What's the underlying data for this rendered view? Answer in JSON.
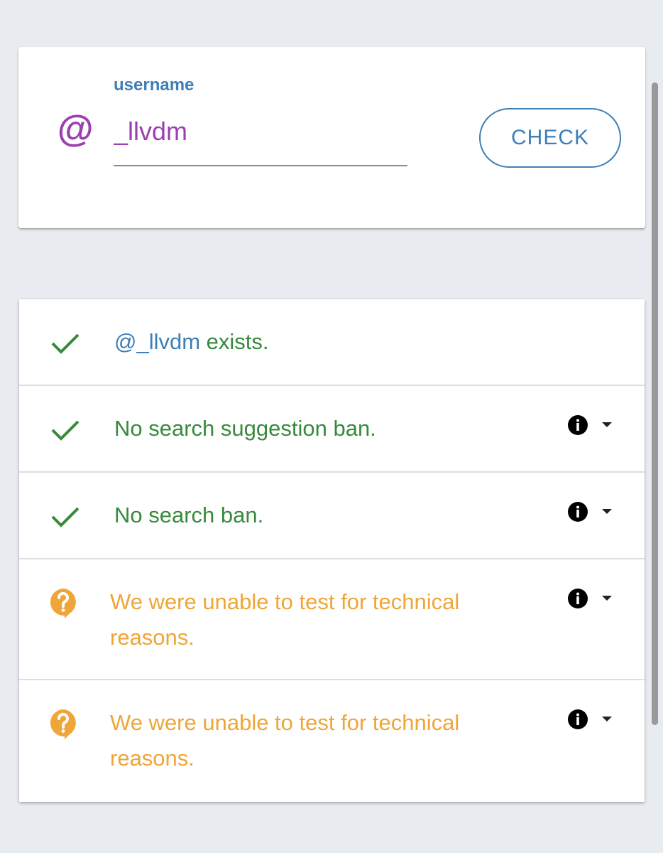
{
  "search": {
    "label": "username",
    "value": "_llvdm",
    "check_label": "CHECK",
    "at_symbol": "@"
  },
  "results": [
    {
      "status": "ok",
      "handle": "@_llvdm",
      "text": " exists."
    },
    {
      "status": "ok",
      "text": "No search suggestion ban."
    },
    {
      "status": "ok",
      "text": "No search ban."
    },
    {
      "status": "unknown",
      "text": "We were unable to test for technical reasons."
    },
    {
      "status": "unknown",
      "text": "We were unable to test for technical reasons."
    }
  ],
  "colors": {
    "accent_purple": "#9c3fb0",
    "accent_blue": "#3d7fb8",
    "status_green": "#378a3b",
    "status_orange": "#efa537"
  },
  "icons": {
    "ok": "check-icon",
    "unknown": "question-bubble-icon",
    "info": "info-icon",
    "expand": "caret-down-icon"
  }
}
